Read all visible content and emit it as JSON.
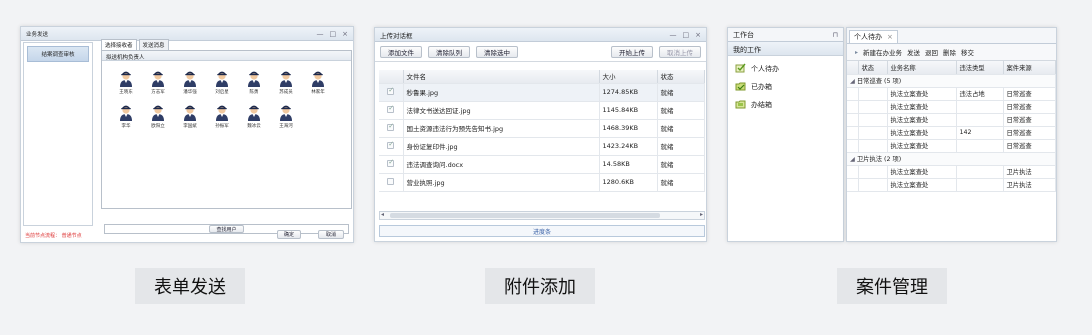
{
  "panel1": {
    "title": "业务发送",
    "window_controls": [
      "—",
      "□",
      "×"
    ],
    "left_selected": "结案调查审核",
    "tabs": [
      "选择接收者",
      "发送消息"
    ],
    "box_header": "拟送机构负责人",
    "persons": [
      "王晓东",
      "方志军",
      "潘华强",
      "刘启星",
      "陈勇",
      "苏成员",
      "林家年",
      "李华",
      "欧阳立",
      "李国斌",
      "孙振军",
      "魏冰云",
      "王海河"
    ],
    "search_button": "查找用户",
    "status_text": "当前节点流程：   普通节点",
    "ok_button": "确定",
    "cancel_button": "取消"
  },
  "panel2": {
    "title": "上传对话框",
    "window_controls": [
      "—",
      "□",
      "×"
    ],
    "toolbar": {
      "add": "添加文件",
      "clear_queue": "清除队列",
      "clear_selected": "清除选中",
      "start_upload": "开始上传",
      "cancel_upload": "取消上传"
    },
    "columns": [
      "文件名",
      "大小",
      "状态"
    ],
    "rows": [
      {
        "name": "秒鲁果.jpg",
        "size": "1274.85KB",
        "status": "就绪",
        "checked": true
      },
      {
        "name": "法律文书送达回证.jpg",
        "size": "1145.84KB",
        "status": "就绪",
        "checked": true
      },
      {
        "name": "国土资源违法行为预先告知书.jpg",
        "size": "1468.39KB",
        "status": "就绪",
        "checked": true
      },
      {
        "name": "身份证复印件.jpg",
        "size": "1423.24KB",
        "status": "就绪",
        "checked": true
      },
      {
        "name": "违法调查询问.docx",
        "size": "14.58KB",
        "status": "就绪",
        "checked": true
      },
      {
        "name": "营业执照.jpg",
        "size": "1280.6KB",
        "status": "就绪",
        "checked": false
      }
    ],
    "progress_label": "进度条"
  },
  "panel3": {
    "title": "工作台",
    "pin_icon": "⊓",
    "section": "我的工作",
    "items": [
      {
        "label": "个人待办",
        "icon": "todo-icon"
      },
      {
        "label": "已办箱",
        "icon": "done-icon"
      },
      {
        "label": "办结箱",
        "icon": "finished-icon"
      }
    ]
  },
  "panel4": {
    "tab_label": "个人待办",
    "toolbar": [
      "新建在办业务",
      "发送",
      "退回",
      "删除",
      "移交"
    ],
    "columns": [
      "状态",
      "业务名称",
      "违法类型",
      "案件来源"
    ],
    "groups": [
      {
        "label": "日常巡查 (5 项)",
        "rows": [
          {
            "name": "执法立案查处",
            "type": "违法占地",
            "source": "日常巡查"
          },
          {
            "name": "执法立案查处",
            "type": "",
            "source": "日常巡查"
          },
          {
            "name": "执法立案查处",
            "type": "",
            "source": "日常巡查"
          },
          {
            "name": "执法立案查处",
            "type": "142",
            "source": "日常巡查"
          },
          {
            "name": "执法立案查处",
            "type": "",
            "source": "日常巡查"
          }
        ]
      },
      {
        "label": "卫片执法 (2 项)",
        "rows": [
          {
            "name": "执法立案查处",
            "type": "",
            "source": "卫片执法"
          },
          {
            "name": "执法立案查处",
            "type": "",
            "source": "卫片执法"
          }
        ]
      }
    ]
  },
  "captions": [
    "表单发送",
    "附件添加",
    "案件管理"
  ]
}
